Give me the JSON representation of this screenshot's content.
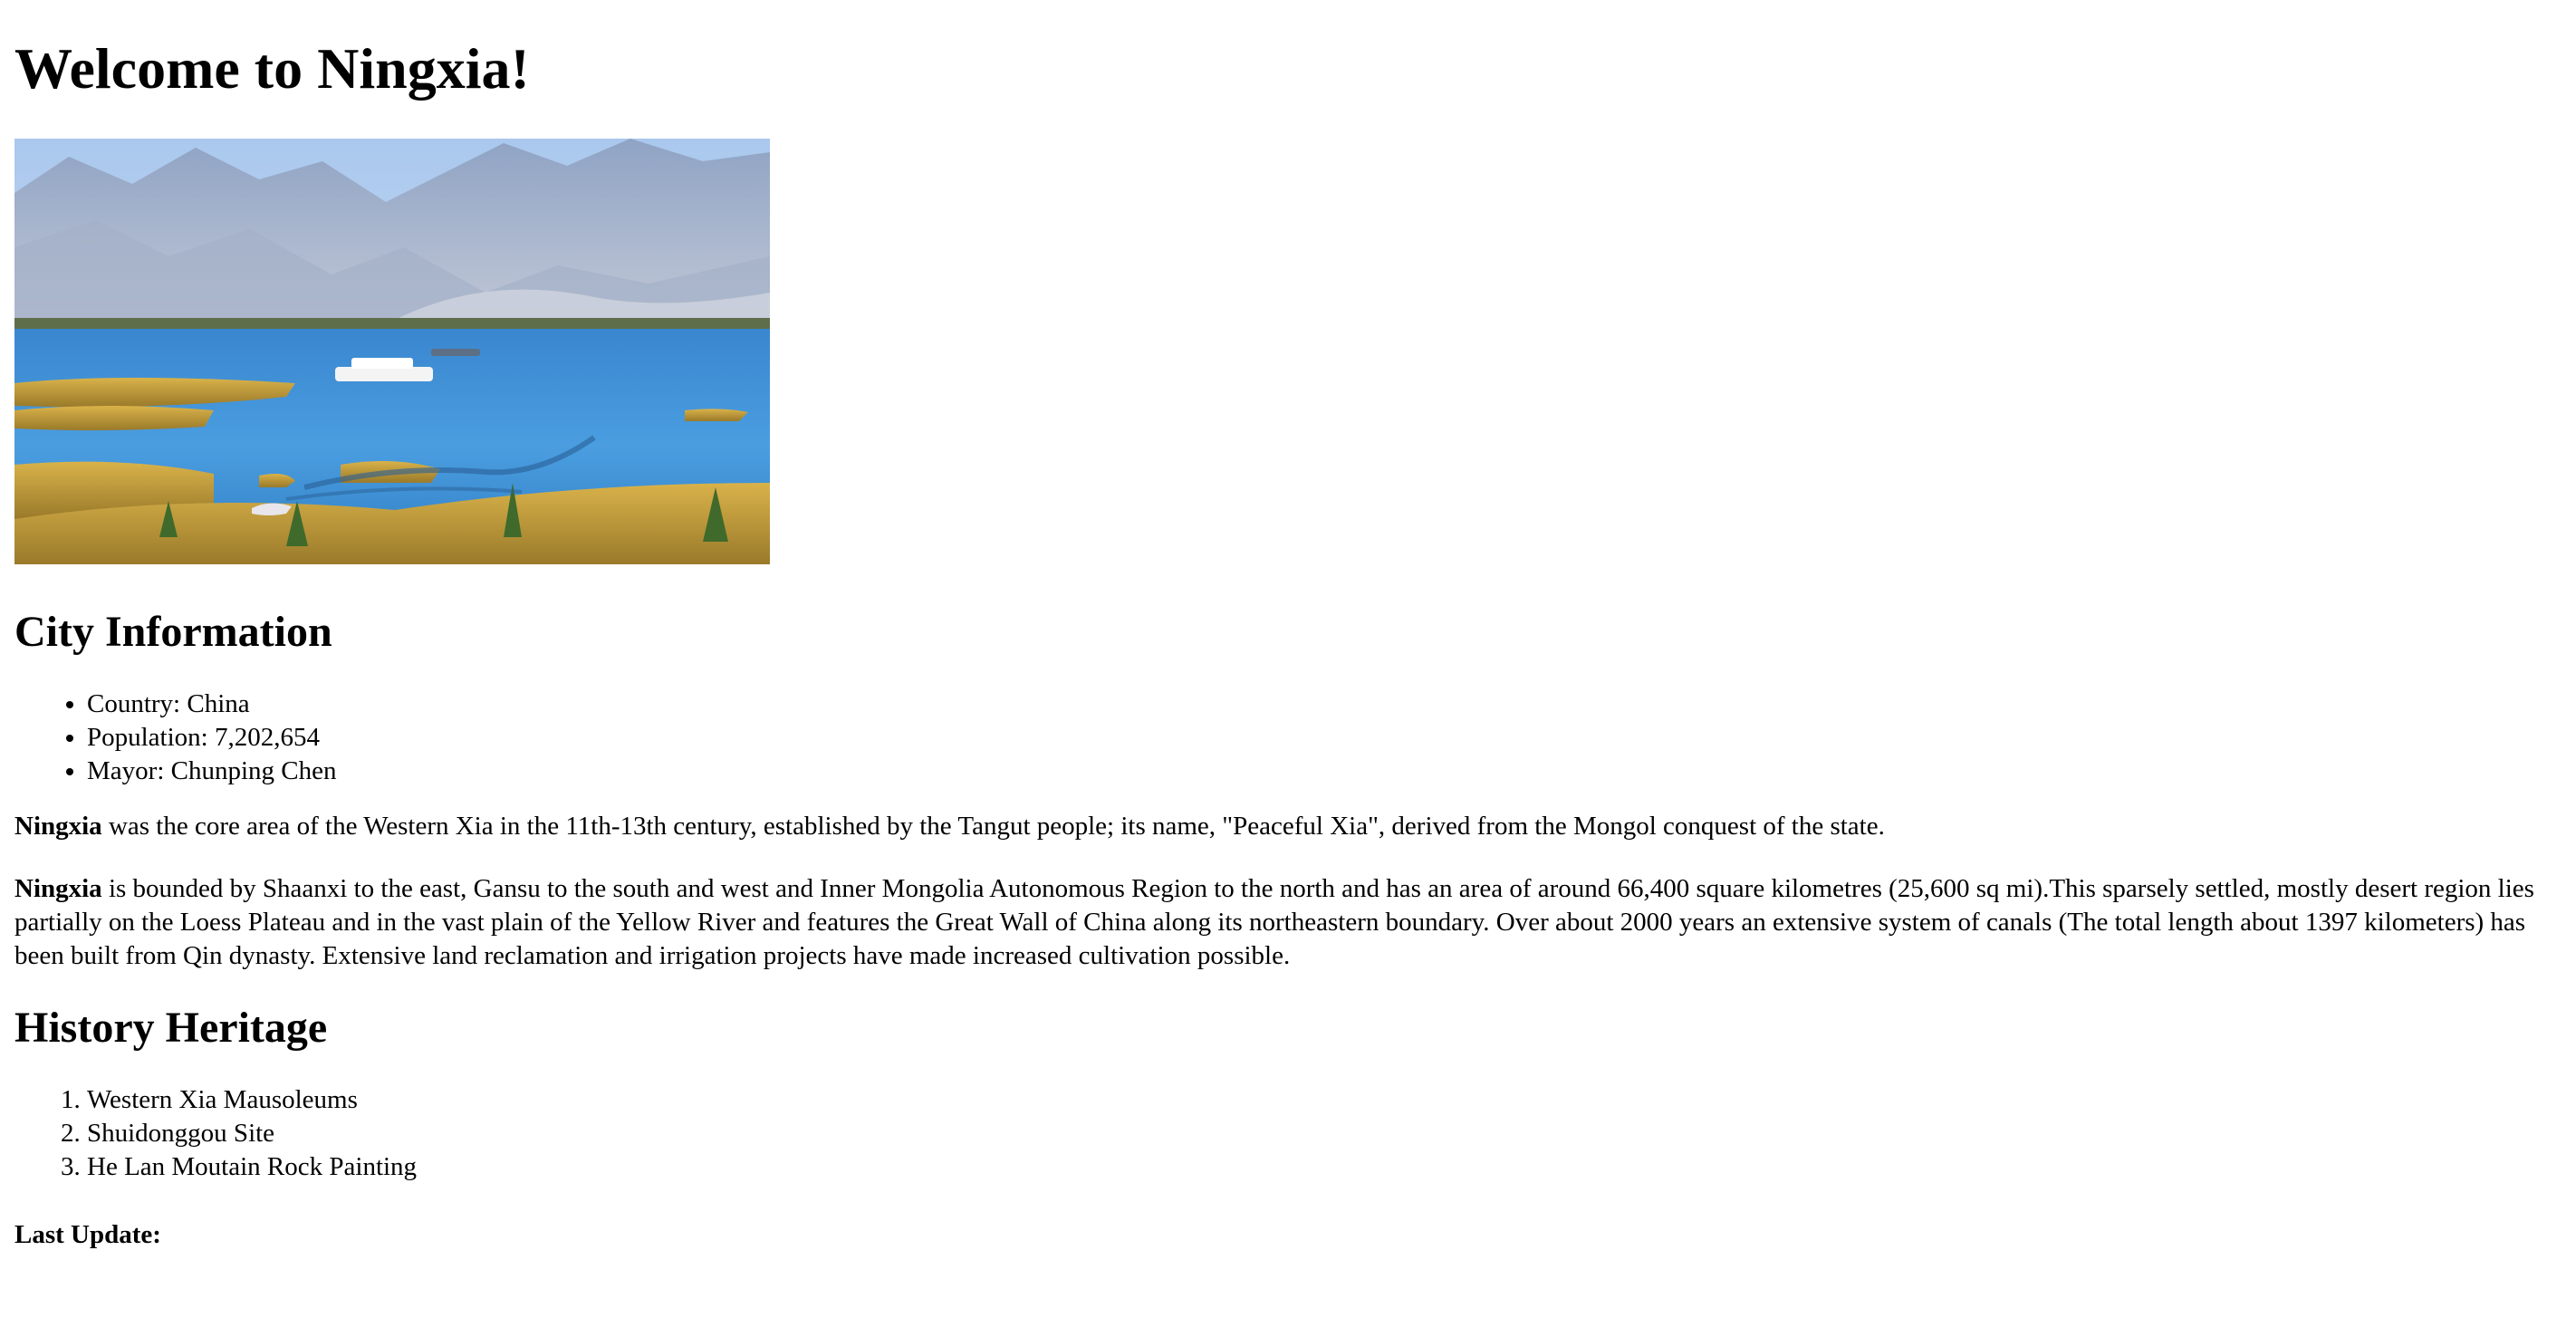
{
  "page": {
    "title": "Welcome to Ningxia!"
  },
  "image": {
    "alt": "Ningxia lake with boats, reeds and mountains"
  },
  "city_info": {
    "heading": "City Information",
    "items": [
      {
        "label": "Country:",
        "value": "China"
      },
      {
        "label": "Population:",
        "value": "7,202,654"
      },
      {
        "label": "Mayor:",
        "value": "Chunping Chen"
      }
    ]
  },
  "paragraphs": [
    {
      "bold": "Ningxia",
      "text": " was the core area of the Western Xia in the 11th-13th century, established by the Tangut people; its name, \"Peaceful Xia\", derived from the Mongol conquest of the state."
    },
    {
      "bold": "Ningxia",
      "text": " is bounded by Shaanxi to the east, Gansu to the south and west and Inner Mongolia Autonomous Region to the north and has an area of around 66,400 square kilometres (25,600 sq mi).This sparsely settled, mostly desert region lies partially on the Loess Plateau and in the vast plain of the Yellow River and features the Great Wall of China along its northeastern boundary. Over about 2000 years an extensive system of canals (The total length about 1397 kilometers) has been built from Qin dynasty. Extensive land reclamation and irrigation projects have made increased cultivation possible."
    }
  ],
  "history": {
    "heading": "History Heritage",
    "items": [
      "Western Xia Mausoleums",
      "Shuidonggou Site",
      "He Lan Moutain Rock Painting"
    ]
  },
  "footer": {
    "last_update_label": "Last Update:"
  }
}
